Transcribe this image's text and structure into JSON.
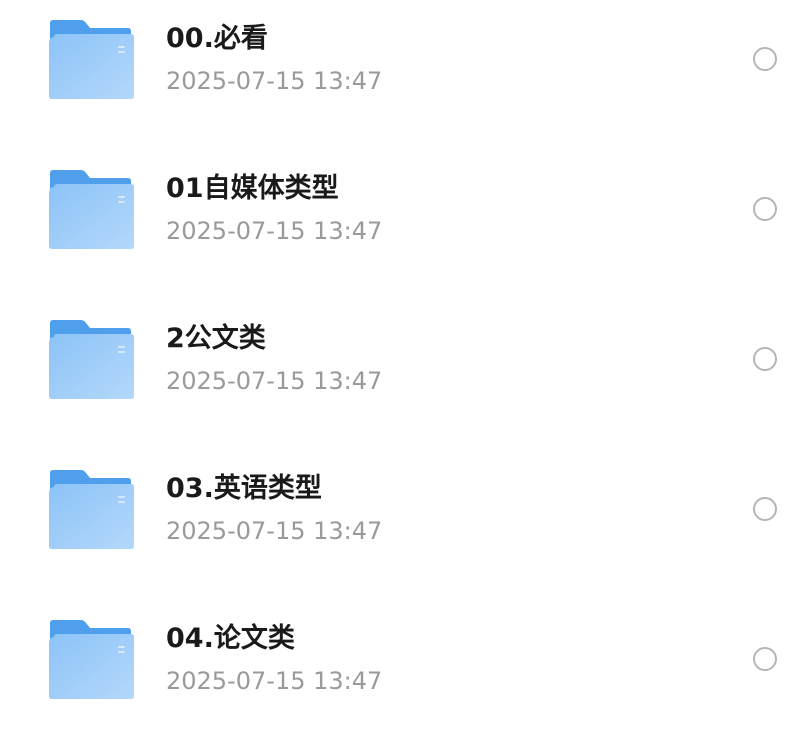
{
  "files": [
    {
      "name": "00.必看",
      "modified": "2025-07-15 13:47"
    },
    {
      "name": "01自媒体类型",
      "modified": "2025-07-15 13:47"
    },
    {
      "name": "2公文类",
      "modified": "2025-07-15 13:47"
    },
    {
      "name": "03.英语类型",
      "modified": "2025-07-15 13:47"
    },
    {
      "name": "04.论文类",
      "modified": "2025-07-15 13:47"
    }
  ],
  "icon": "folder-icon",
  "colors": {
    "folder_back": "#4f9fec",
    "folder_front_top": "#8cc3f7",
    "folder_front_bottom": "#b4d8fb",
    "title": "#1a1a1a",
    "timestamp": "#9a9a9a",
    "radio_border": "#b5b5b5"
  }
}
